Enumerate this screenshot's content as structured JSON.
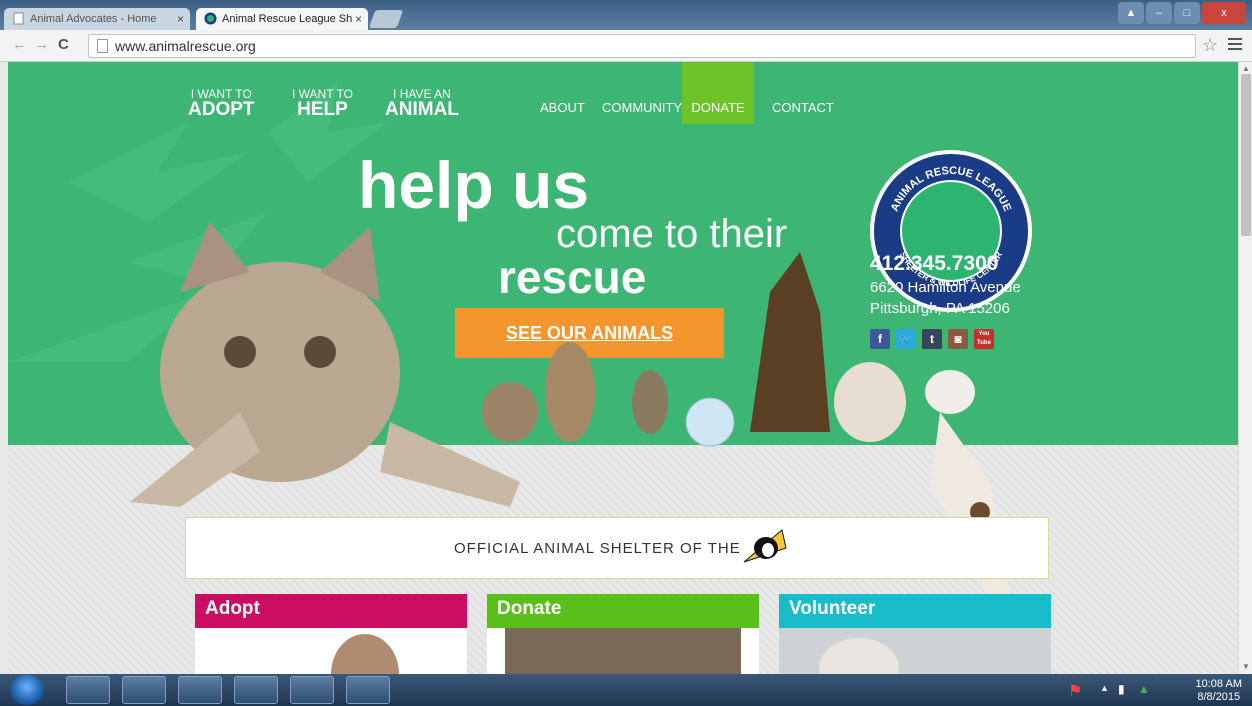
{
  "browser": {
    "tabs": [
      {
        "label": "Animal Advocates - Home",
        "close": "×"
      },
      {
        "label": "Animal Rescue League Sh",
        "close": "×"
      }
    ],
    "url": "www.animalrescue.org"
  },
  "site": {
    "nav_big": [
      {
        "small": "I WANT TO",
        "big": "ADOPT"
      },
      {
        "small": "I WANT TO",
        "big": "HELP"
      },
      {
        "small": "I HAVE AN",
        "big": "ANIMAL"
      }
    ],
    "nav_small": [
      "ABOUT",
      "COMMUNITY",
      "DONATE",
      "CONTACT"
    ],
    "headline": {
      "line1": "help us",
      "line2": "come to their",
      "line3": "rescue"
    },
    "cta": "SEE OUR ANIMALS",
    "logo": {
      "top_text": "ANIMAL RESCUE LEAGUE",
      "bottom_text": "SHELTER & WILDLIFE CENTER"
    },
    "phone": "412.345.7300",
    "address_line1": "6620 Hamilton Avenue",
    "address_line2": "Pittsburgh, PA 15206",
    "social": [
      {
        "icon": "facebook-icon",
        "glyph": "f",
        "color": "#3b5998"
      },
      {
        "icon": "twitter-icon",
        "glyph": "t",
        "color": "#2aa9e0"
      },
      {
        "icon": "tumblr-icon",
        "glyph": "t",
        "color": "#35465c"
      },
      {
        "icon": "instagram-icon",
        "glyph": "◙",
        "color": "#8a5a44"
      },
      {
        "icon": "youtube-icon",
        "glyph": "You Tube",
        "color": "#c4302b"
      }
    ],
    "banner": "OFFICIAL ANIMAL SHELTER OF THE",
    "cards": [
      {
        "title": "Adopt",
        "color": "#cc0e63"
      },
      {
        "title": "Donate",
        "color": "#5abf1b"
      },
      {
        "title": "Volunteer",
        "color": "#19bcc9"
      }
    ]
  },
  "taskbar": {
    "time": "10:08 AM",
    "date": "8/8/2015"
  }
}
